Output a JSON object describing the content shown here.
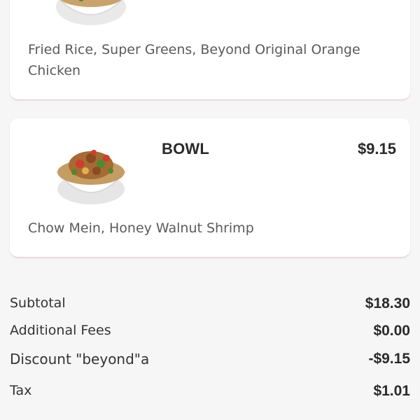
{
  "items": [
    {
      "description": "Fried Rice, Super Greens, Beyond Original Orange Chicken"
    },
    {
      "name": "BOWL",
      "price": "$9.15",
      "description": "Chow Mein, Honey Walnut Shrimp"
    }
  ],
  "summary": {
    "subtotal_label": "Subtotal",
    "subtotal_value": "$18.30",
    "fees_label": "Additional Fees",
    "fees_value": "$0.00",
    "discount_label": "Discount \"beyond\"a",
    "discount_value": "-$9.15",
    "tax_label": "Tax",
    "tax_value": "$1.01"
  },
  "colors": {
    "background": "#f6f6f6",
    "card": "#ffffff",
    "card_border_accent": "#f0c9c9",
    "text_dark": "#2a2a2a",
    "text_muted": "#5a5a5a"
  },
  "icons": {
    "item_image": "food-bowl-icon"
  }
}
